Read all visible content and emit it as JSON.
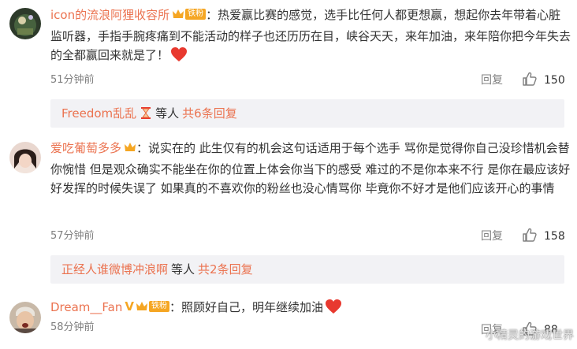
{
  "comments": [
    {
      "username": "icon的流浪阿狸收容所",
      "badge_label": "铁粉",
      "text": "热爱赢比赛的感觉，选手比任何人都更想赢，想起你去年带着心脏监听器，手指手腕疼痛到不能活动的样子也还历历在目，峡谷天天，来年加油，来年陪你把今年失去的全都赢回来就是了！",
      "time": "51分钟前",
      "reply_label": "回复",
      "likes": "150",
      "reply_bar": {
        "name": "Freedom乱乱",
        "etc": "等人",
        "total": "共6条回复"
      }
    },
    {
      "username": "爱吃葡萄多多",
      "text": "说实在的 此生仅有的机会这句话适用于每个选手 骂你是觉得你自己没珍惜机会替你惋惜 但是观众确实不能坐在你的位置上体会你当下的感受 难过的不是你本来不行 是你在最应该好好发挥的时候失误了 如果真的不喜欢你的粉丝也没心情骂你 毕竟你不好才是他们应该开心的事情",
      "time": "57分钟前",
      "reply_label": "回复",
      "likes": "158",
      "reply_bar": {
        "name": "正经人谁微博冲浪啊",
        "etc": "等人",
        "total": "共2条回复"
      }
    },
    {
      "username": "Dream__Fan",
      "verified_mark": "V",
      "badge_label": "铁粉",
      "text": "照顾好自己，明年继续加油",
      "time": "58分钟前",
      "reply_label": "回复",
      "likes": "88"
    }
  ],
  "separator": "：",
  "watermark": "小精灵的游戏世界",
  "colors": {
    "username": "#eb7350",
    "fan_badge": "#f5a623",
    "heart": "#e8392f",
    "reply_bar_bg": "#f2f2f5",
    "meta": "#808080"
  },
  "icons": {
    "like": "thumbs-up-icon",
    "heart": "heart-icon",
    "hourglass": "hourglass-icon",
    "crown": "fan-crown-icon"
  }
}
